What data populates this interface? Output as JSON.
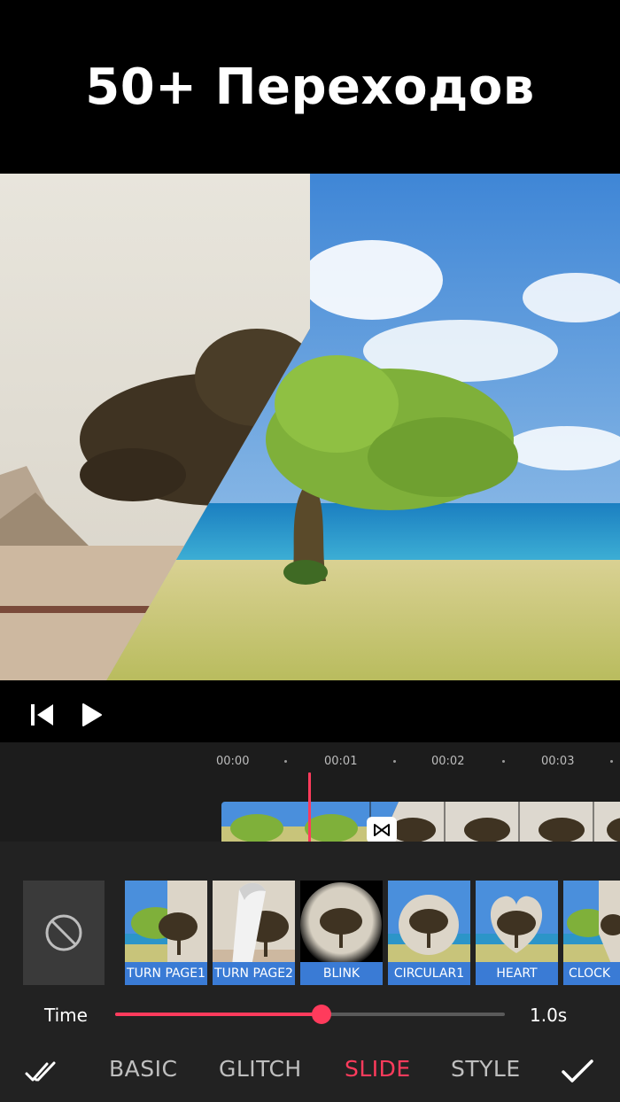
{
  "banner": {
    "title": "50+ Переходов"
  },
  "player": {
    "icons": [
      "skip-to-start-icon",
      "play-icon"
    ]
  },
  "timeline": {
    "ticks": [
      "00:00",
      "00:01",
      "00:02",
      "00:03"
    ],
    "transition_icon": "bowtie-transition-icon"
  },
  "transitions": {
    "none_icon": "no-symbol-icon",
    "items": [
      {
        "label": "TURN PAGE1"
      },
      {
        "label": "TURN PAGE2"
      },
      {
        "label": "BLINK"
      },
      {
        "label": "CIRCULAR1"
      },
      {
        "label": "HEART"
      },
      {
        "label": "CLOCK"
      }
    ]
  },
  "duration": {
    "label": "Time",
    "value": "1.0s",
    "fraction": 0.53
  },
  "tabs": {
    "items": [
      "BASIC",
      "GLITCH",
      "SLIDE",
      "STYLE"
    ],
    "active": "SLIDE",
    "apply_all_icon": "double-check-icon",
    "confirm_icon": "checkmark-icon"
  },
  "colors": {
    "accent": "#ff3b5c",
    "label_bg": "#3a7bd5",
    "panel_bg": "#222222"
  }
}
